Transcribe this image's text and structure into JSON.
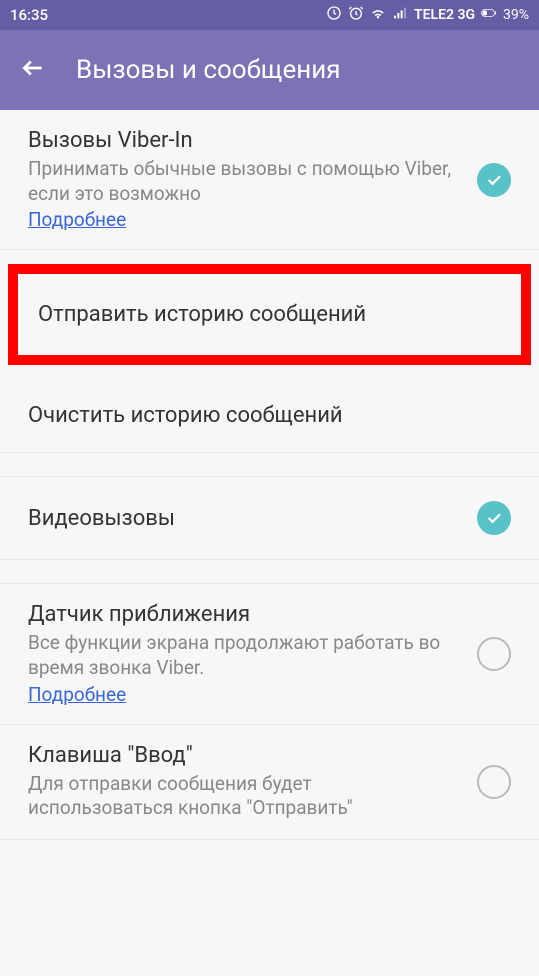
{
  "statusBar": {
    "time": "16:35",
    "carrier": "TELE2 3G",
    "battery": "39%"
  },
  "header": {
    "title": "Вызовы и сообщения"
  },
  "settings": {
    "viberIn": {
      "title": "Вызовы Viber-In",
      "desc": "Принимать обычные вызовы с помощью Viber, если это возможно",
      "link": "Подробнее"
    },
    "sendHistory": {
      "title": "Отправить историю сообщений"
    },
    "clearHistory": {
      "title": "Очистить историю сообщений"
    },
    "videoCalls": {
      "title": "Видеовызовы"
    },
    "proximitySensor": {
      "title": "Датчик приближения",
      "desc": "Все функции экрана продолжают работать во время звонка Viber.",
      "link": "Подробнее"
    },
    "enterKey": {
      "title": "Клавиша \"Ввод\"",
      "desc": "Для отправки сообщения будет использоваться кнопка \"Отправить\""
    }
  }
}
